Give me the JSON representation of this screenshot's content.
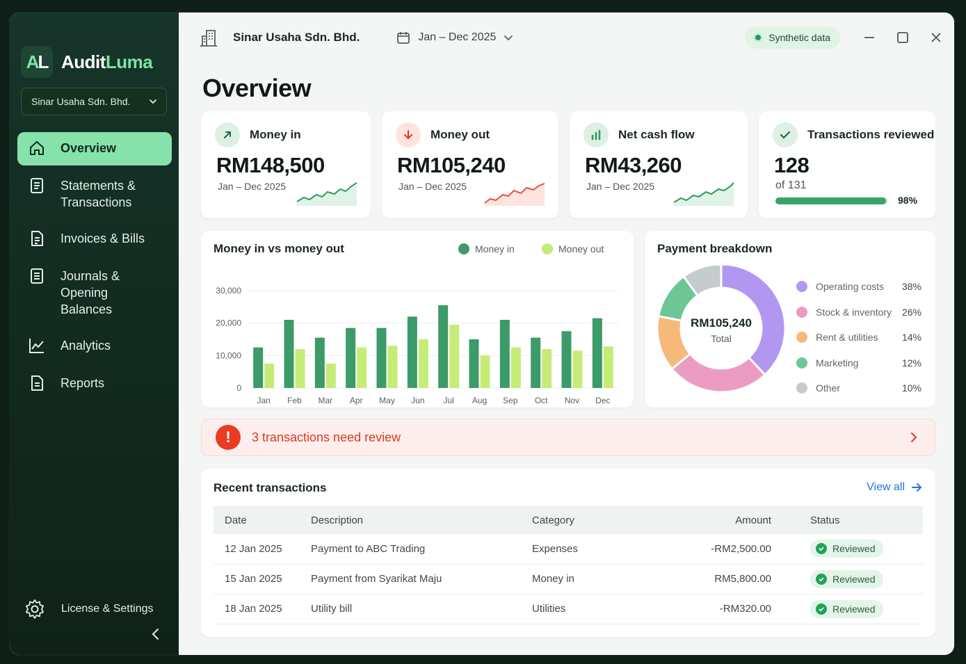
{
  "app": {
    "brand_main": "Audit",
    "brand_accent": "Luma",
    "logo_letter": "A"
  },
  "sidebar": {
    "company_select": "Sinar Usaha Sdn. Bhd.",
    "items": [
      {
        "label": "Overview",
        "icon": "home-icon",
        "active": true
      },
      {
        "label": "Statements &\nTransactions",
        "icon": "document-icon"
      },
      {
        "label": "Invoices & Bills",
        "icon": "invoice-icon"
      },
      {
        "label": "Journals &\nOpening Balances",
        "icon": "journal-icon"
      },
      {
        "label": "Analytics",
        "icon": "line-chart-icon"
      },
      {
        "label": "Reports",
        "icon": "report-icon"
      }
    ],
    "settings_label": "License & Settings"
  },
  "topbar": {
    "company": "Sinar Usaha Sdn. Bhd.",
    "date_range": "Jan – Dec 2025",
    "badge": "Synthetic data"
  },
  "page": {
    "title": "Overview"
  },
  "kpis": {
    "money_in": {
      "label": "Money in",
      "value": "RM148,500",
      "period": "Jan – Dec 2025"
    },
    "money_out": {
      "label": "Money out",
      "value": "RM105,240",
      "period": "Jan – Dec 2025"
    },
    "net_cash": {
      "label": "Net cash flow",
      "value": "RM43,260",
      "period": "Jan – Dec 2025"
    },
    "reviewed": {
      "label": "Transactions reviewed",
      "value": "128",
      "of": "of 131",
      "percent": "98%",
      "progress": 0.98
    }
  },
  "colors": {
    "money_in": "#3c9b68",
    "money_out": "#c6ec78",
    "accent": "#86e2ab",
    "alert": "#ea3b24"
  },
  "chart_data": [
    {
      "type": "bar",
      "title": "Money in vs money out",
      "categories": [
        "Jan",
        "Feb",
        "Mar",
        "Apr",
        "May",
        "Jun",
        "Jul",
        "Aug",
        "Sep",
        "Oct",
        "Nov",
        "Dec"
      ],
      "series": [
        {
          "name": "Money in",
          "values": [
            12500,
            21000,
            15500,
            18500,
            18500,
            22000,
            25500,
            15000,
            21000,
            15500,
            17500,
            21500
          ]
        },
        {
          "name": "Money out",
          "values": [
            7500,
            12000,
            7500,
            12500,
            13000,
            15000,
            19500,
            10000,
            12500,
            12000,
            11500,
            12800
          ]
        }
      ],
      "y_ticks": [
        "30,000",
        "20,000",
        "10,000",
        "0"
      ],
      "ylim": [
        0,
        30000
      ],
      "legend": "top-right"
    },
    {
      "type": "pie",
      "title": "Payment breakdown",
      "center_value": "RM105,240",
      "center_label": "Total",
      "slices": [
        {
          "name": "Operating costs",
          "percent": 38,
          "label": "38%",
          "color": "#b197f2"
        },
        {
          "name": "Stock & inventory",
          "percent": 26,
          "label": "26%",
          "color": "#ec9cc2"
        },
        {
          "name": "Rent & utilities",
          "percent": 14,
          "label": "14%",
          "color": "#f7b97a"
        },
        {
          "name": "Marketing",
          "percent": 12,
          "label": "12%",
          "color": "#6cc795"
        },
        {
          "name": "Other",
          "percent": 10,
          "label": "10%",
          "color": "#c6cbcd"
        }
      ],
      "legend": "right"
    }
  ],
  "alert": {
    "message": "3 transactions need review"
  },
  "transactions": {
    "title": "Recent transactions",
    "view_all": "View all",
    "columns": [
      "Date",
      "Description",
      "Category",
      "Amount",
      "Status"
    ],
    "rows": [
      {
        "date": "12 Jan 2025",
        "description": "Payment to ABC Trading",
        "category": "Expenses",
        "amount": "-RM2,500.00",
        "status": "Reviewed"
      },
      {
        "date": "15 Jan 2025",
        "description": "Payment from Syarikat Maju",
        "category": "Money in",
        "amount": "RM5,800.00",
        "status": "Reviewed"
      },
      {
        "date": "18 Jan 2025",
        "description": "Utility bill",
        "category": "Utilities",
        "amount": "-RM320.00",
        "status": "Reviewed"
      }
    ]
  }
}
